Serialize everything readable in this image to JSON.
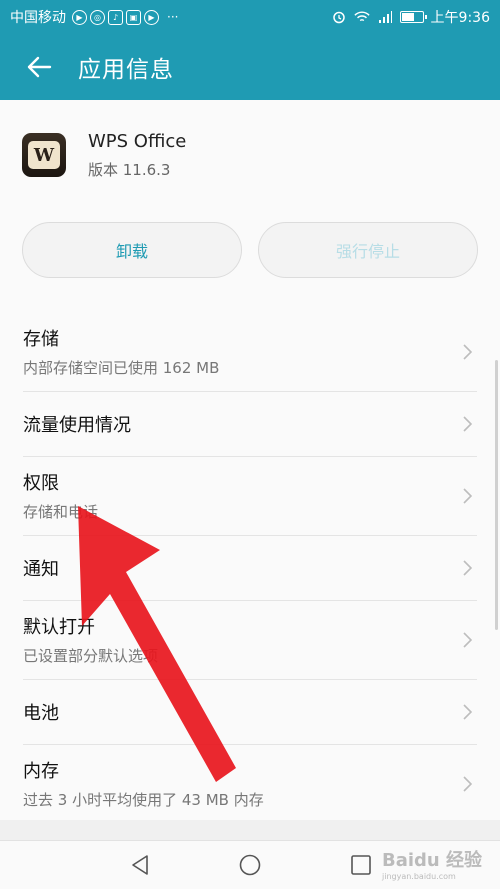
{
  "status_bar": {
    "carrier": "中国移动",
    "apps": [
      "app-a",
      "app-b",
      "app-c",
      "app-d",
      "app-e"
    ],
    "more": "···",
    "network": "2G",
    "time": "上午9:36",
    "battery_level": 0.55
  },
  "app_bar": {
    "title": "应用信息"
  },
  "app": {
    "name": "WPS Office",
    "version": "版本 11.6.3",
    "logo_letter": "W"
  },
  "actions": {
    "uninstall": "卸载",
    "force_stop": "强行停止"
  },
  "list": [
    {
      "title": "存储",
      "subtitle": "内部存储空间已使用 162 MB"
    },
    {
      "title": "流量使用情况",
      "subtitle": ""
    },
    {
      "title": "权限",
      "subtitle": "存储和电话"
    },
    {
      "title": "通知",
      "subtitle": ""
    },
    {
      "title": "默认打开",
      "subtitle": "已设置部分默认选项"
    },
    {
      "title": "电池",
      "subtitle": ""
    },
    {
      "title": "内存",
      "subtitle": "过去 3 小时平均使用了 43 MB 内存"
    }
  ],
  "watermark": {
    "brand": "Baidu 经验",
    "url": "jingyan.baidu.com"
  },
  "colors": {
    "accent": "#1f9bb3",
    "arrow": "#e8161d"
  }
}
